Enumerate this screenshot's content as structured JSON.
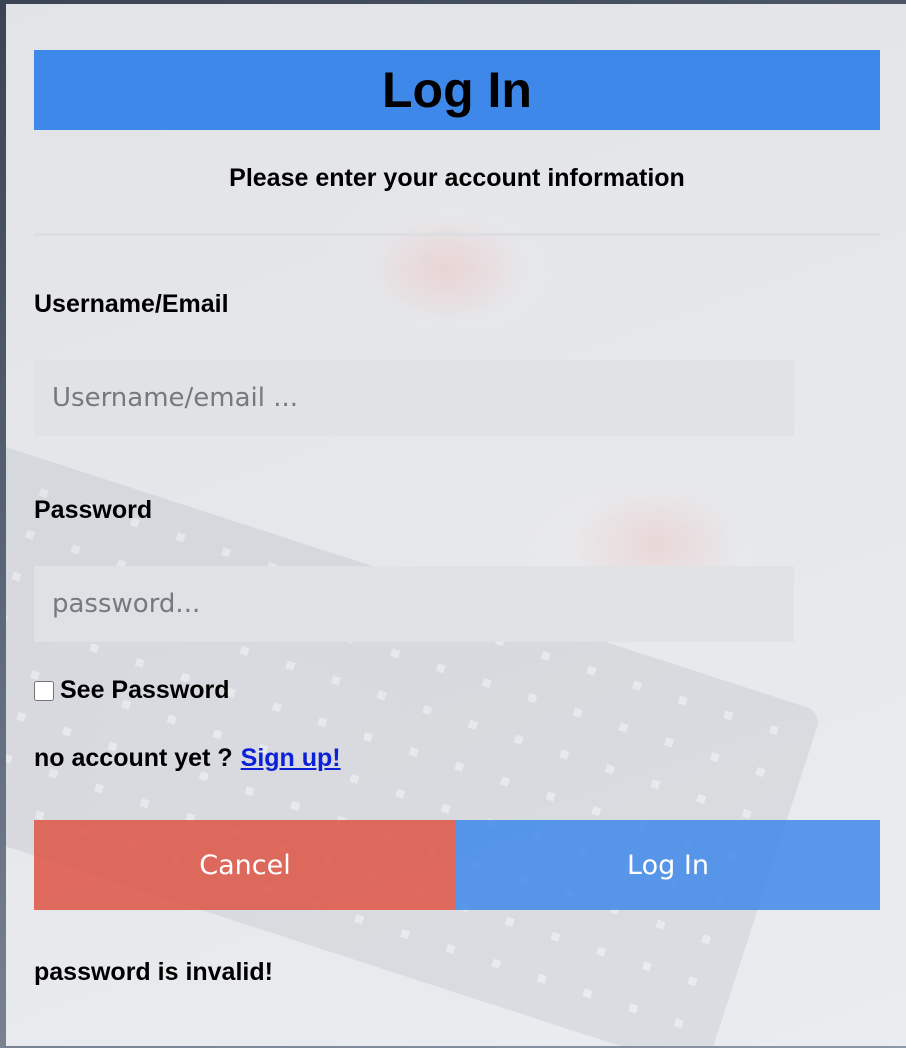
{
  "header": {
    "title": "Log In"
  },
  "subtitle": "Please enter your account information",
  "form": {
    "username": {
      "label": "Username/Email",
      "placeholder": "Username/email ...",
      "value": ""
    },
    "password": {
      "label": "Password",
      "placeholder": "password...",
      "value": ""
    },
    "see_password": {
      "label": "See Password",
      "checked": false
    },
    "signup": {
      "prompt": "no account yet ?",
      "link_text": "Sign up!"
    }
  },
  "buttons": {
    "cancel_label": "Cancel",
    "login_label": "Log In"
  },
  "error_message": "password is invalid!",
  "colors": {
    "header_bg": "#3e88e9",
    "cancel_bg": "#de5c4e",
    "login_bg": "#3e88e9",
    "link": "#0b20d8"
  }
}
